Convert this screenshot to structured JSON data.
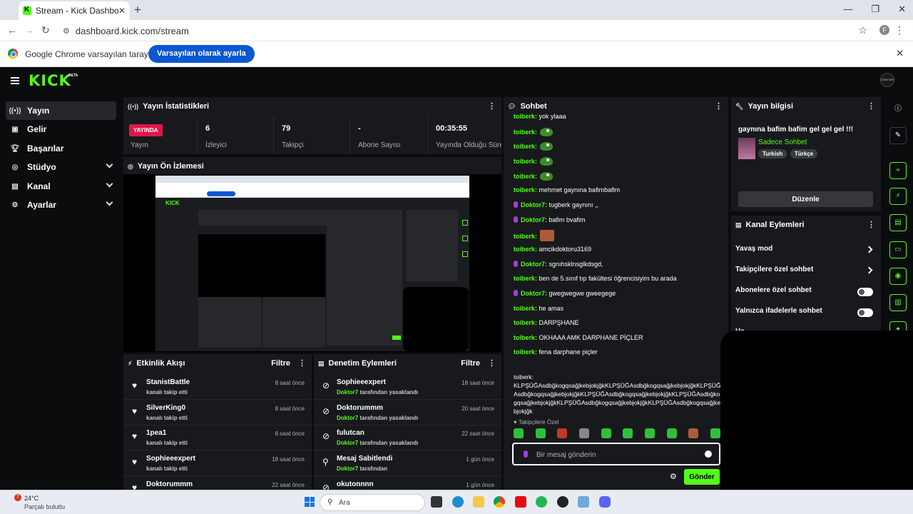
{
  "browser": {
    "tab_title": "Stream - Kick Dashboard",
    "url": "dashboard.kick.com/stream",
    "profile_initial": "F",
    "infobar_text": "Google Chrome varsayılan tarayıcınız değil",
    "infobar_button": "Varsayılan olarak ayarla"
  },
  "header": {
    "logo": "KICK",
    "beta": "BETA",
    "avatar_text": "DOKTOR7"
  },
  "sidebar": {
    "items": [
      {
        "label": "Yayın",
        "icon": "broadcast-icon"
      },
      {
        "label": "Gelir",
        "icon": "wallet-icon"
      },
      {
        "label": "Başarılar",
        "icon": "trophy-icon"
      },
      {
        "label": "Stüdyo",
        "icon": "studio-icon"
      },
      {
        "label": "Kanal",
        "icon": "channel-icon"
      },
      {
        "label": "Ayarlar",
        "icon": "gear-icon"
      }
    ]
  },
  "stats": {
    "title": "Yayın İstatistikleri",
    "live": "YAYINDA",
    "items": [
      {
        "value": "",
        "label": "Yayın"
      },
      {
        "value": "6",
        "label": "İzleyici"
      },
      {
        "value": "79",
        "label": "Takipçi"
      },
      {
        "value": "-",
        "label": "Abone Sayısı"
      },
      {
        "value": "00:35:55",
        "label": "Yayında Olduğu Süre"
      }
    ]
  },
  "preview": {
    "title": "Yayın Ön İzlemesi"
  },
  "events": {
    "title": "Etkinlik Akışı",
    "filter": "Filtre",
    "rows": [
      {
        "name": "StanistBattle",
        "sub": "kanalı takip etti",
        "time": "8 saat önce"
      },
      {
        "name": "SilverKing0",
        "sub": "kanalı takip etti",
        "time": "8 saat önce"
      },
      {
        "name": "1pea1",
        "sub": "kanalı takip etti",
        "time": "8 saat önce"
      },
      {
        "name": "Sophieeexpert",
        "sub": "kanalı takip etti",
        "time": "18 saat önce"
      },
      {
        "name": "Doktorummm",
        "sub": "",
        "time": "22 saat önce"
      }
    ]
  },
  "moderation": {
    "title": "Denetim Eylemleri",
    "filter": "Filtre",
    "rows": [
      {
        "name": "Sophieeexpert",
        "by": "Doktor7",
        "sub": " tarafından yasaklandı",
        "time": "18 saat önce"
      },
      {
        "name": "Doktorummm",
        "by": "Doktor7",
        "sub": " tarafından yasaklandı",
        "time": "20 saat önce"
      },
      {
        "name": "fulutcan",
        "by": "Doktor7",
        "sub": " tarafından yasaklandı",
        "time": "22 saat önce"
      },
      {
        "name": "Mesaj Sabitlendi",
        "by": "Doktor7",
        "sub": " tarafından",
        "time": "1 gün önce"
      },
      {
        "name": "okutonnnn",
        "by": "",
        "sub": "",
        "time": "1 gün önce"
      }
    ]
  },
  "chat": {
    "title": "Sohbet",
    "messages": [
      {
        "user": "toiberk:",
        "text": " yok ylaaa",
        "mic": false,
        "emote": ""
      },
      {
        "user": "toiberk:",
        "text": "",
        "mic": false,
        "emote": "frog"
      },
      {
        "user": "toiberk:",
        "text": "",
        "mic": false,
        "emote": "frog"
      },
      {
        "user": "toiberk:",
        "text": "",
        "mic": false,
        "emote": "frog"
      },
      {
        "user": "toiberk:",
        "text": "",
        "mic": false,
        "emote": "frog"
      },
      {
        "user": "toiberk:",
        "text": " mehmet gaynına bafimbafim",
        "mic": false,
        "emote": ""
      },
      {
        "user": "Doktor7:",
        "text": " tugberk gaynını ,,",
        "mic": true,
        "emote": ""
      },
      {
        "user": "Doktor7:",
        "text": " bafim bvafim",
        "mic": true,
        "emote": ""
      },
      {
        "user": "toiberk:",
        "text": "",
        "mic": false,
        "emote": "beef"
      },
      {
        "user": "toiberk:",
        "text": " amcikdoktoru3169",
        "mic": false,
        "emote": ""
      },
      {
        "user": "Doktor7:",
        "text": " sgnıhsklnsglkdsgd,",
        "mic": true,
        "emote": ""
      },
      {
        "user": "toiberk:",
        "text": " ben de 5.sınıf tıp fakültesi öğrencisiyim bu arada",
        "mic": false,
        "emote": ""
      },
      {
        "user": "Doktor7:",
        "text": " gwegwegwe gweegege",
        "mic": true,
        "emote": ""
      },
      {
        "user": "toiberk:",
        "text": " he amas",
        "mic": false,
        "emote": ""
      },
      {
        "user": "toiberk:",
        "text": " DARPŞHANE",
        "mic": false,
        "emote": ""
      },
      {
        "user": "toiberk:",
        "text": " OKHAAA AMK DARPHANE PİÇLER",
        "mic": false,
        "emote": ""
      },
      {
        "user": "toiberk:",
        "text": " fena darphane piçler",
        "mic": false,
        "emote": ""
      }
    ],
    "long_user": "toiberk:",
    "long_text": "KLPŞÜĞAsdbğkogqsağjkebjokjğkKLPŞÜĞAsdbğkogqsağjkebjokjğkKLPŞÜĞAsdbğkogqsağjkebjokjğkKLPŞÜĞAsdbğkogqsağjkebjokjğkKLPŞÜĞAsdbğkogqsağjkebjokjğkKLPŞÜĞAsdbğkogqsağjkebjokjğkKLPŞÜĞAsdbğkogqsağjkebjokjğk",
    "follow_only": "Takipçilere Özel",
    "input_placeholder": "Bir mesaj gönderin",
    "send": "Gönder"
  },
  "stream_info": {
    "title": "Yayın bilgisi",
    "stream_title": "gaynına bafim bafim gel gel gel !!!",
    "category": "Sadece Sohbet",
    "tags": [
      "Turkish",
      "Türkçe"
    ],
    "edit": "Düzenle"
  },
  "channel_actions": {
    "title": "Kanal Eylemleri",
    "rows": [
      {
        "label": "Yavaş mod",
        "type": "arrow"
      },
      {
        "label": "Takipçilere özel sohbet",
        "type": "arrow"
      },
      {
        "label": "Abonelere özel sohbet",
        "type": "toggle"
      },
      {
        "label": "Yalnızca ifadelerle sohbet",
        "type": "toggle"
      },
      {
        "label": "Ha",
        "type": "arrow"
      }
    ]
  },
  "taskbar": {
    "weather_badge": "7",
    "temp": "24°C",
    "weather": "Parçalı bulutlu",
    "search": "Ara"
  },
  "colors": {
    "accent": "#53fc18",
    "live": "#e0164a",
    "panel": "#18191c",
    "bg": "#0b0c0e"
  }
}
